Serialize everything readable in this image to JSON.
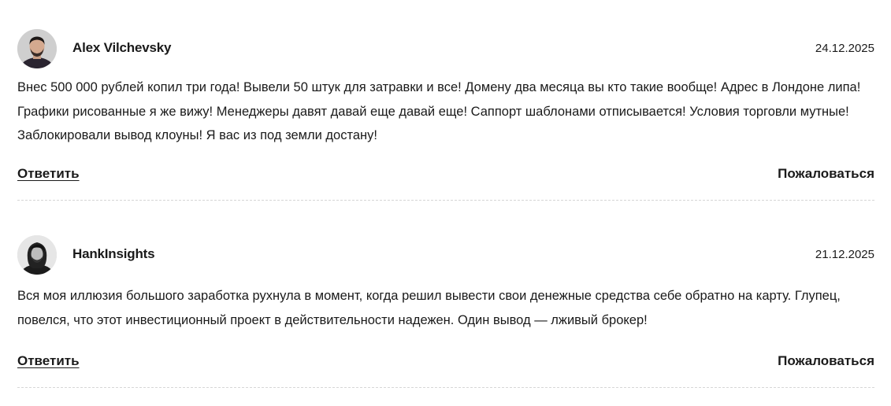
{
  "comments": [
    {
      "author": "Alex Vilchevsky",
      "date": "24.12.2025",
      "text": "Внес 500 000 рублей копил три года! Вывели 50 штук для затравки и все! Домену два месяца вы кто такие вообще! Адрес в Лондоне липа! Графики рисованные я же вижу! Менеджеры давят давай еще давай еще! Саппорт шаблонами отписывается! Условия торговли мутные! Заблокировали вывод клоуны! Я вас из под земли достану!",
      "reply_label": "Ответить",
      "report_label": "Пожаловаться"
    },
    {
      "author": "HankInsights",
      "date": "21.12.2025",
      "text": "Вся моя иллюзия большого заработка рухнула в момент, когда решил вывести свои денежные средства себе обратно на карту. Глупец, повелся, что этот инвестиционный проект в действительности надежен. Один вывод — лживый брокер!",
      "reply_label": "Ответить",
      "report_label": "Пожаловаться"
    }
  ]
}
